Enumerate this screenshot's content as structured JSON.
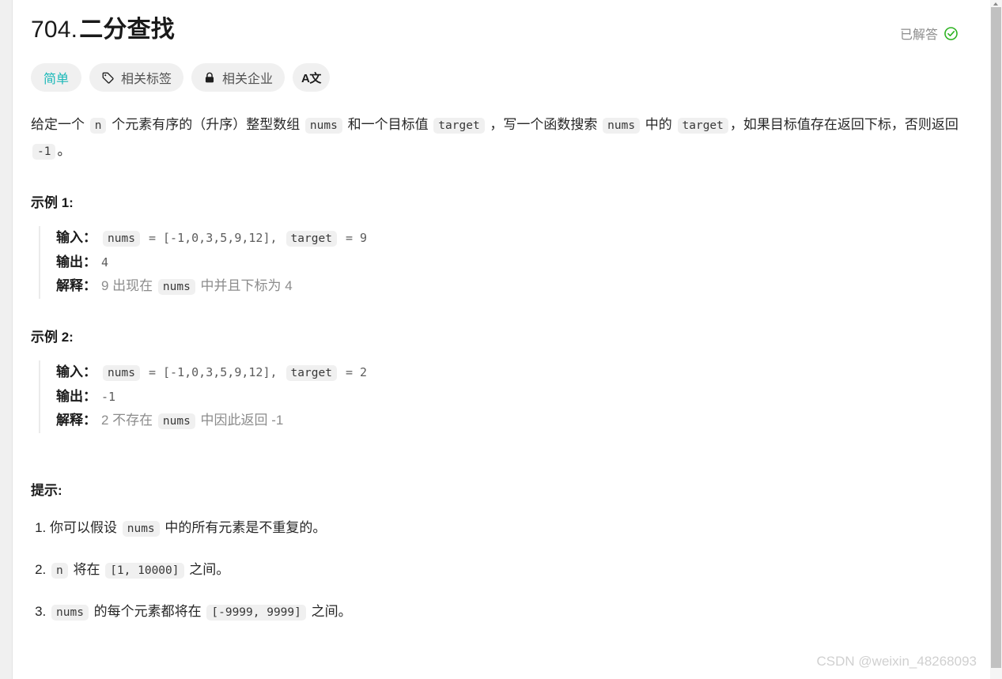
{
  "window": {
    "scroll_position": "top"
  },
  "header": {
    "problem_number": "704.",
    "problem_title": "二分查找",
    "status_label": "已解答",
    "status_icon": "check-circle-icon",
    "status_color": "#2db321"
  },
  "pills": [
    {
      "label": "简单",
      "icon": null,
      "name": "difficulty-badge",
      "accent": "#1ab8b8"
    },
    {
      "label": "相关标签",
      "icon": "tag-icon",
      "name": "related-tags-button"
    },
    {
      "label": "相关企业",
      "icon": "lock-icon",
      "name": "related-companies-button"
    },
    {
      "label": "A文",
      "icon": "translate-icon",
      "name": "language-toggle-button"
    }
  ],
  "description": {
    "part1": "给定一个 ",
    "code1": "n",
    "part2": " 个元素有序的（升序）整型数组 ",
    "code2": "nums",
    "part3": " 和一个目标值 ",
    "code3": "target",
    "part4": " ，写一个函数搜索 ",
    "code4": "nums",
    "part5": " 中的 ",
    "code5": "target",
    "part6": "，如果目标值存在返回下标，否则返回 ",
    "code6": "-1",
    "part7": "。"
  },
  "examples": [
    {
      "heading": "示例 1:",
      "input_label": "输入：",
      "input_code1": "nums",
      "input_mid": " = [-1,0,3,5,9,12], ",
      "input_code2": "target",
      "input_tail": " = 9",
      "output_label": "输出：",
      "output_value": "4",
      "explain_label": "解释：",
      "explain_pre": "9 出现在 ",
      "explain_code": "nums",
      "explain_post": " 中并且下标为 4"
    },
    {
      "heading": "示例 2:",
      "input_label": "输入：",
      "input_code1": "nums",
      "input_mid": " = [-1,0,3,5,9,12], ",
      "input_code2": "target",
      "input_tail": " = 2",
      "output_label": "输出：",
      "output_value": "-1",
      "explain_label": "解释：",
      "explain_pre": "2 不存在 ",
      "explain_code": "nums",
      "explain_post": " 中因此返回 -1"
    }
  ],
  "constraints": {
    "heading": "提示:",
    "items": [
      {
        "pre": "你可以假设 ",
        "code": "nums",
        "post": " 中的所有元素是不重复的。",
        "code2": null,
        "post2": null
      },
      {
        "pre": "",
        "code": "n",
        "post": " 将在 ",
        "code2": "[1, 10000]",
        "post2": " 之间。"
      },
      {
        "pre": "",
        "code": "nums",
        "post": " 的每个元素都将在 ",
        "code2": "[-9999, 9999]",
        "post2": " 之间。"
      }
    ]
  },
  "watermark": "CSDN @weixin_48268093"
}
